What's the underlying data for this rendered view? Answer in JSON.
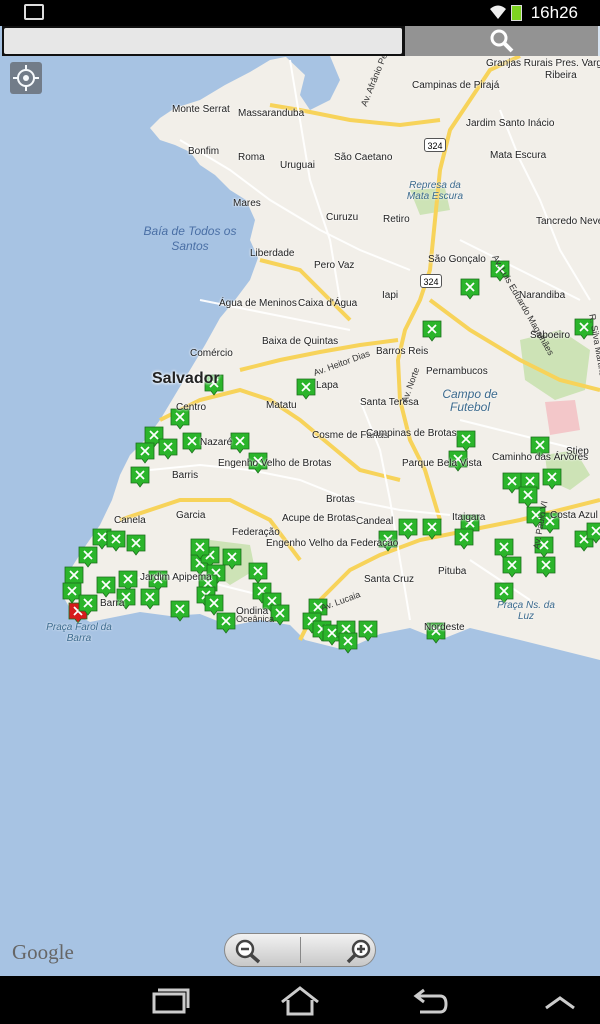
{
  "status_bar": {
    "time": "16h26"
  },
  "search": {
    "placeholder": "",
    "value": ""
  },
  "map": {
    "city_label": "Salvador",
    "water_labels": [
      "Baía de Todos os Santos"
    ],
    "poi_labels": [
      "Represa da Mata Escura",
      "Campo de Futebol",
      "Praça Farol da Barra",
      "Praça Ns. da Luz"
    ],
    "neighborhoods": [
      "Mal. Rondon",
      "Pirajá",
      "Granjas Rurais Pres. Vargas",
      "Ribeira",
      "Campinas de Pirajá",
      "Monte Serrat",
      "Massaranduba",
      "Jardim Santo Inácio",
      "Bonfim",
      "Roma",
      "Uruguai",
      "São Caetano",
      "Mata Escura",
      "Mares",
      "Curuzu",
      "Retiro",
      "Tancredo Neves",
      "Liberdade",
      "Pero Vaz",
      "São Gonçalo",
      "Narandiba",
      "Iapi",
      "Água de Meninos",
      "Caixa d'Água",
      "Saboeiro",
      "Baixa de Quintas",
      "Barros Reis",
      "Comércio",
      "Pernambucos",
      "Lapa",
      "Santa Teresa",
      "Centro",
      "Matatu",
      "Nazaré",
      "Cosme de Farias",
      "Campinas de Brotas",
      "Stiep",
      "Engenho Velho de Brotas",
      "Parque Bela Vista",
      "Caminho das Árvores",
      "Barris",
      "Garcia",
      "Canela",
      "Federação",
      "Acupe de Brotas",
      "Brotas",
      "Candeal",
      "Itaigara",
      "Costa Azul",
      "Engenho Velho da Federação",
      "Santa Cruz",
      "Pituba",
      "Ondina",
      "Nordeste",
      "Barra",
      "Jardim Apipema"
    ],
    "road_labels": [
      "Av. Afrânio Peixoto",
      "Av. Luis Eduardo Magalhães",
      "Av. Heitor Dias",
      "Av. Norte",
      "Av. Paulo VI",
      "R. Silva Martins",
      "Av. Lucaia",
      "Oceânica"
    ],
    "highway_numbers": [
      "324",
      "324"
    ],
    "marker_count": 110
  },
  "controls": {
    "attribution": "Google",
    "zoom_out_icon": "zoom-out-icon",
    "zoom_in_icon": "zoom-in-icon",
    "locate_icon": "my-location-icon"
  },
  "nav_bar": {
    "icons": [
      "recent-apps-icon",
      "home-icon",
      "back-icon",
      "menu-up-icon"
    ]
  },
  "colors": {
    "water": "#a7c3e3",
    "land": "#f2efe9",
    "marker": "#2bb52b",
    "marker_selected": "#d61c1c"
  }
}
